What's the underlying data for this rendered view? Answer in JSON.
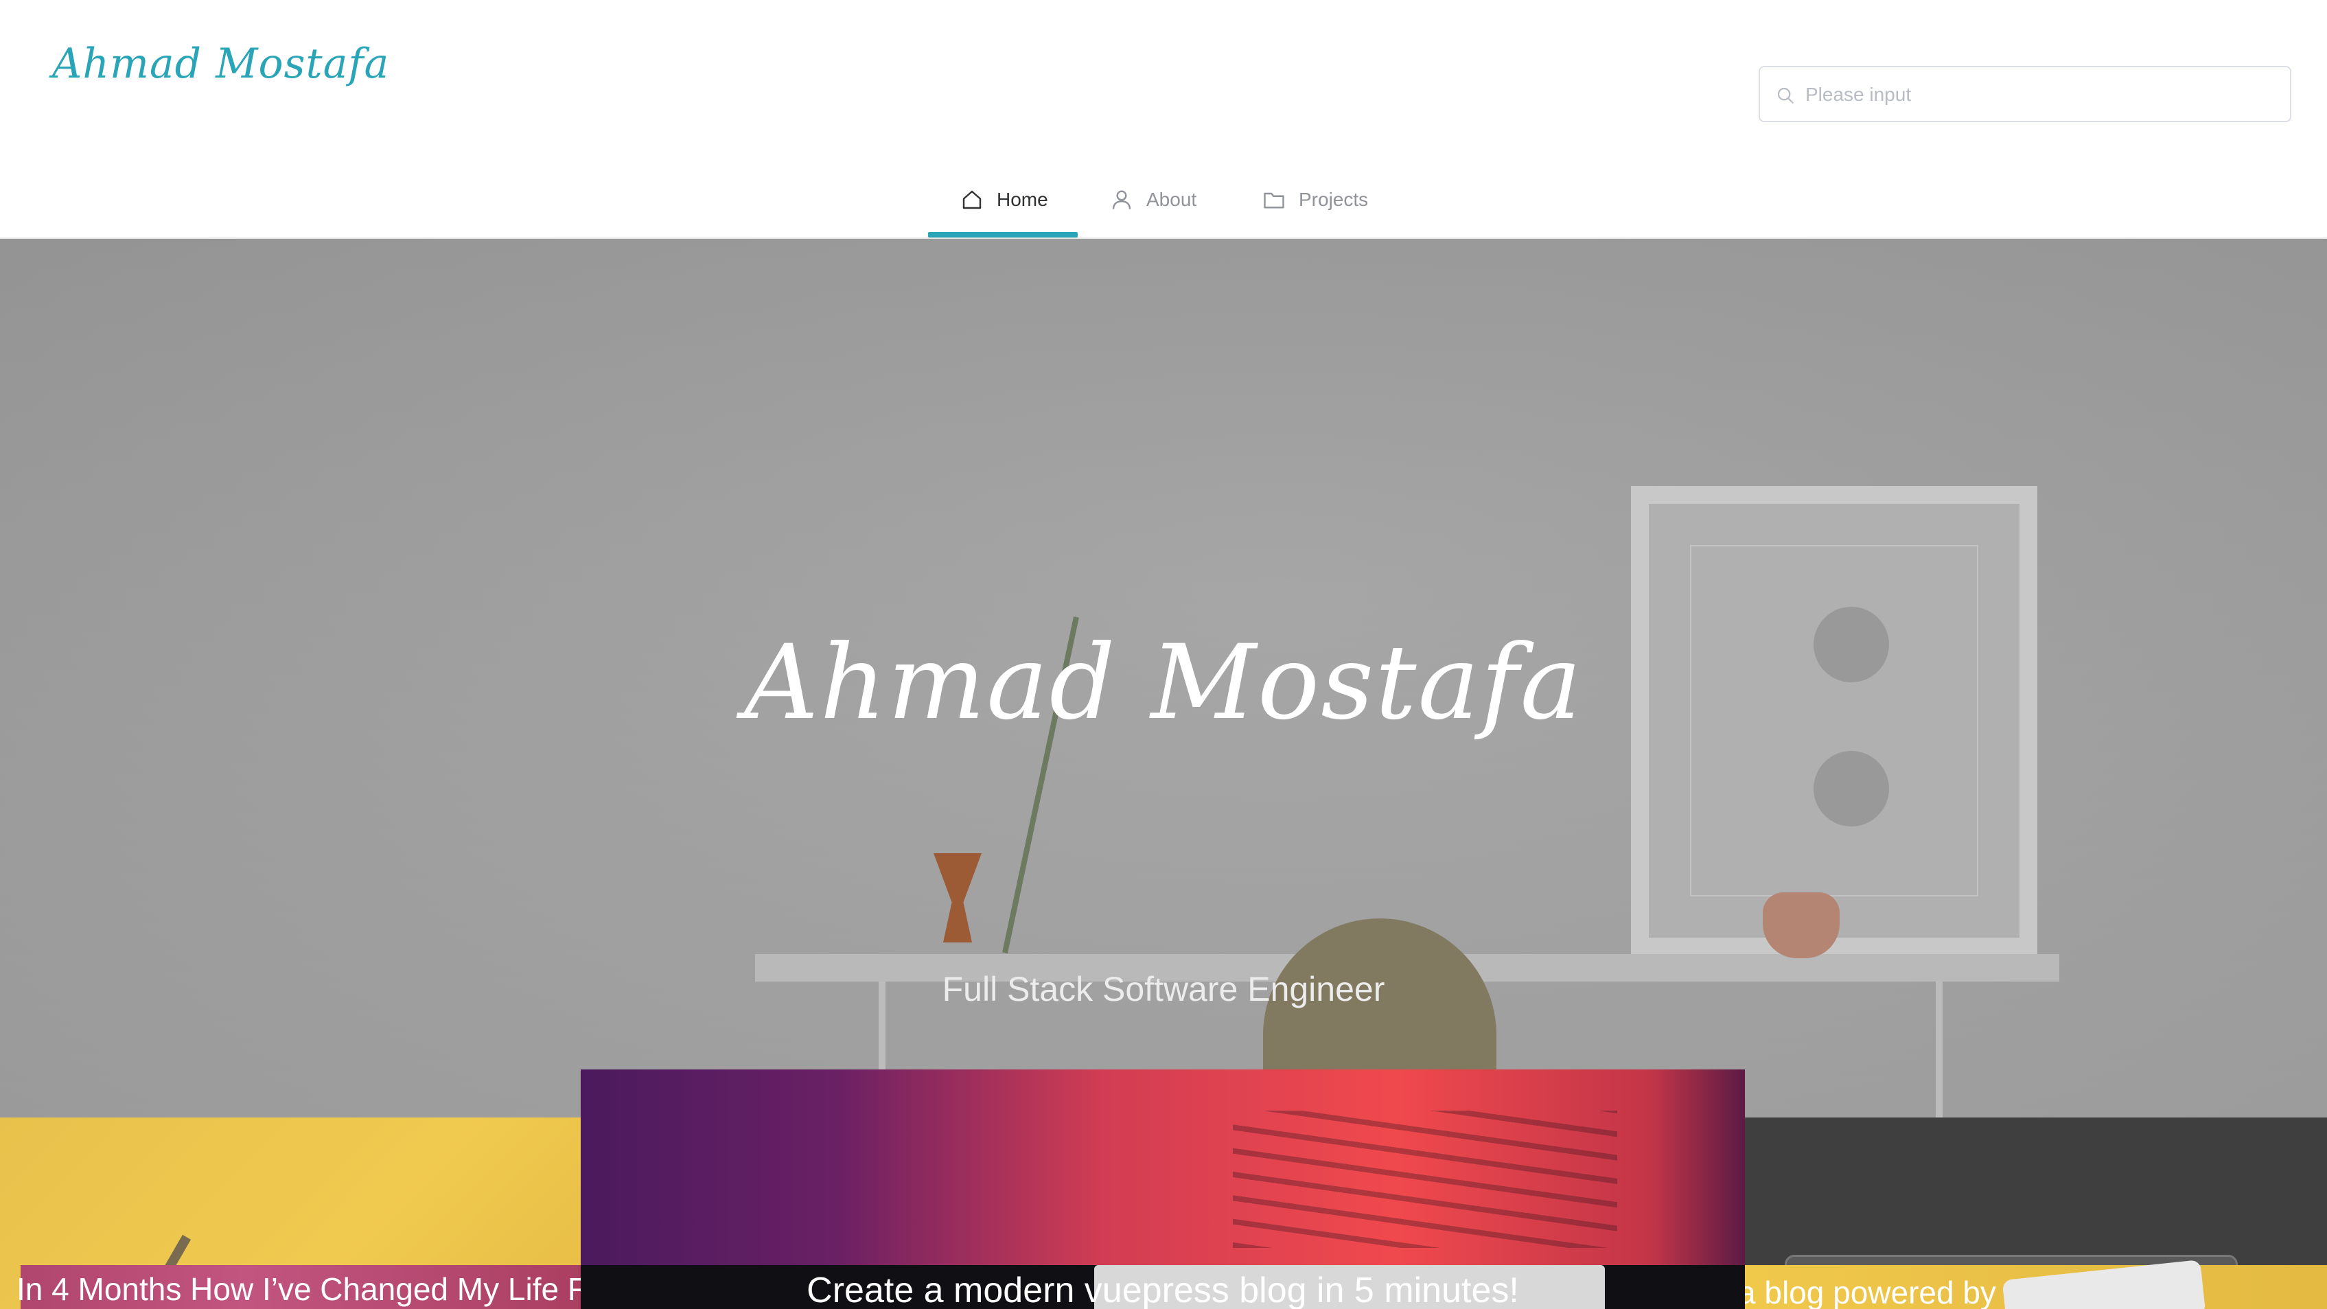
{
  "header": {
    "logo_text": "Ahmad Mostafa",
    "search": {
      "placeholder": "Please input",
      "value": "",
      "icon": "search-icon"
    }
  },
  "nav": {
    "items": [
      {
        "label": "Home",
        "icon": "home-icon",
        "active": true
      },
      {
        "label": "About",
        "icon": "user-icon",
        "active": false
      },
      {
        "label": "Projects",
        "icon": "folder-icon",
        "active": false
      }
    ],
    "accent_color": "#2aa5b8"
  },
  "hero": {
    "title": "Ahmad Mostafa",
    "subtitle": "Full Stack Software Engineer"
  },
  "posts": [
    {
      "title": "In 4 Months How I’ve Changed My Life Fr"
    },
    {
      "title": "Create a modern vuepress blog in 5 minutes!"
    },
    {
      "title": "a blog powered by"
    }
  ]
}
